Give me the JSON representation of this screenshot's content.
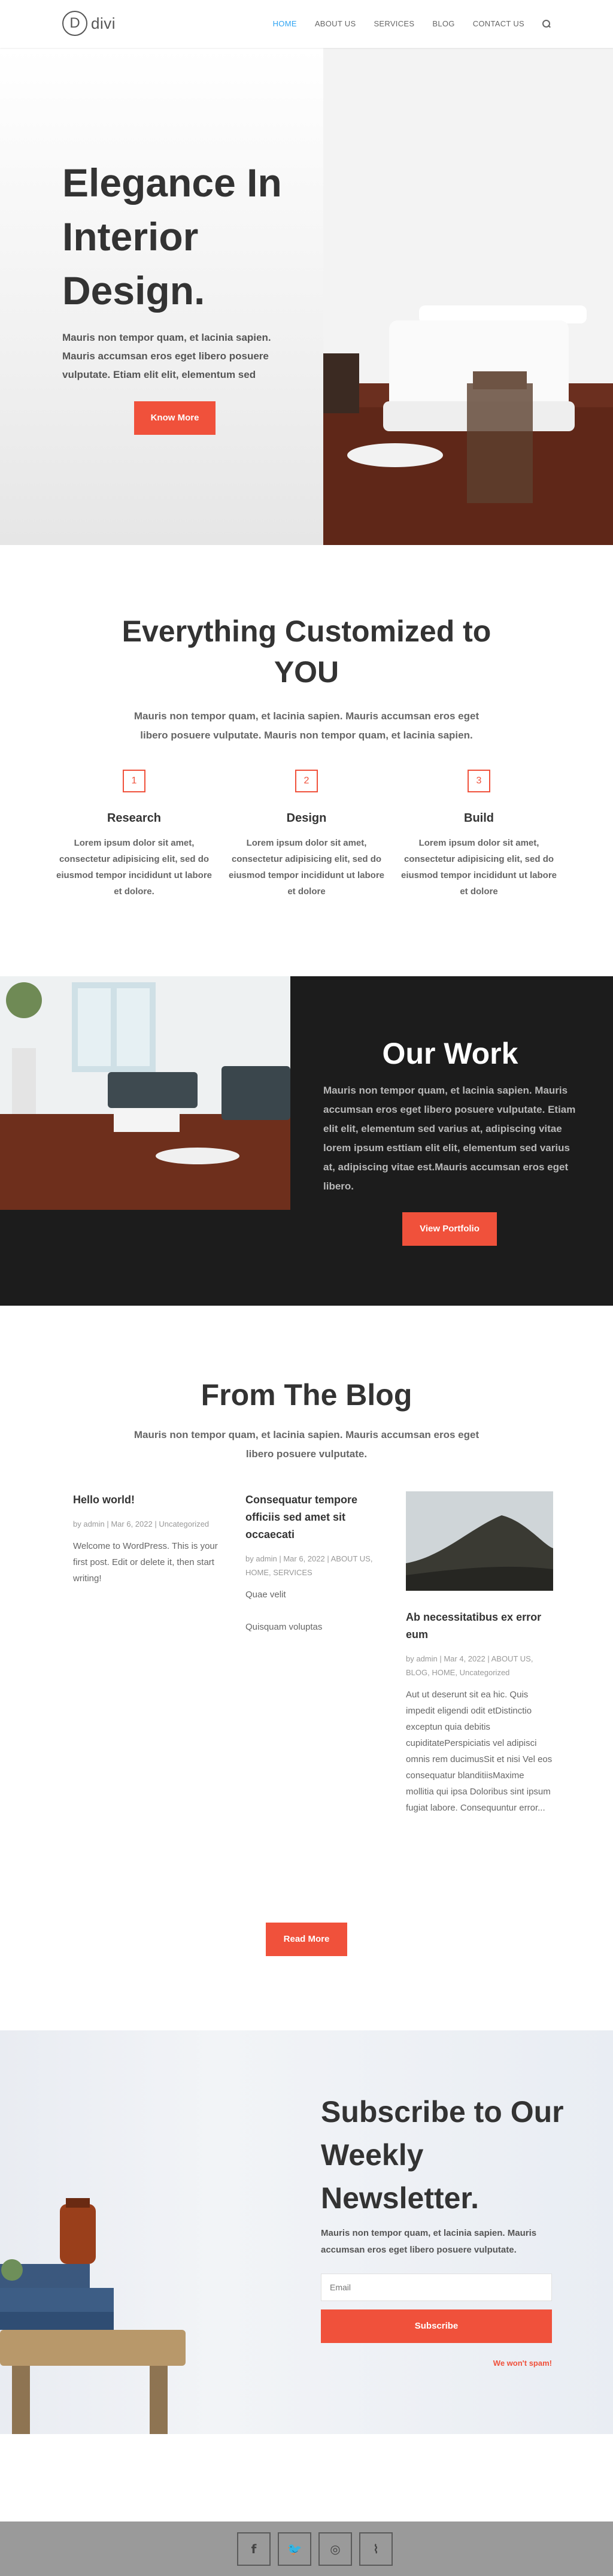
{
  "header": {
    "logo_mark": "D",
    "logo_text": "divi",
    "nav": [
      "HOME",
      "ABOUT US",
      "SERVICES",
      "BLOG",
      "CONTACT US"
    ],
    "accent": "#2ea3f2"
  },
  "hero": {
    "title": "Elegance In Interior Design.",
    "text": "Mauris non tempor quam, et lacinia sapien. Mauris accumsan eros eget libero posuere vulputate. Etiam elit elit, elementum sed",
    "button": "Know More"
  },
  "custom": {
    "title": "Everything Customized to YOU",
    "subtitle": "Mauris non tempor quam, et lacinia sapien. Mauris accumsan eros eget libero posuere vulputate. Mauris non tempor quam, et lacinia sapien.",
    "features": [
      {
        "num": "1",
        "title": "Research",
        "text": "Lorem ipsum dolor sit amet, consectetur adipisicing elit, sed do eiusmod tempor incididunt ut labore et dolore."
      },
      {
        "num": "2",
        "title": "Design",
        "text": "Lorem ipsum dolor sit amet, consectetur adipisicing elit, sed do eiusmod tempor incididunt ut labore et dolore"
      },
      {
        "num": "3",
        "title": "Build",
        "text": "Lorem ipsum dolor sit amet, consectetur adipisicing elit, sed do eiusmod tempor incididunt ut labore et dolore"
      }
    ]
  },
  "work": {
    "title": "Our Work",
    "text": "Mauris non tempor quam, et lacinia sapien. Mauris accumsan eros eget libero posuere vulputate. Etiam elit elit, elementum sed varius at, adipiscing vitae lorem ipsum esttiam elit elit, elementum sed varius at, adipiscing vitae est.Mauris accumsan eros eget libero.",
    "button": "View Portfolio"
  },
  "blog": {
    "title": "From The Blog",
    "subtitle": "Mauris non tempor quam, et lacinia sapien. Mauris accumsan eros eget libero posuere vulputate.",
    "posts": [
      {
        "title": "Hello world!",
        "meta": "by admin | Mar 6, 2022 | Uncategorized",
        "body": "Welcome to WordPress. This is your first post. Edit or delete it, then start writing!"
      },
      {
        "title": "Consequatur tempore officiis sed amet sit occaecati",
        "meta": "by admin | Mar 6, 2022 | ABOUT US, HOME, SERVICES",
        "body": "Quae velit\n\nQuisquam voluptas"
      },
      {
        "title": "Ab necessitatibus ex error eum",
        "meta": "by admin | Mar 4, 2022 | ABOUT US, BLOG, HOME, Uncategorized",
        "body": "Aut ut deserunt sit ea hic. Quis impedit eligendi odit etDistinctio exceptun quia debitis cupiditatePerspiciatis vel adipisci omnis rem ducimusSit et nisi Vel eos consequatur blanditiisMaxime mollitia qui ipsa Doloribus sint ipsum fugiat labore. Consequuntur error..."
      }
    ],
    "button": "Read More"
  },
  "newsletter": {
    "title": "Subscribe to Our Weekly Newsletter.",
    "text": "Mauris non tempor quam, et lacinia sapien. Mauris accumsan eros eget libero posuere vulputate.",
    "email_placeholder": "Email",
    "button": "Subscribe",
    "spam": "We won't spam!"
  },
  "footer": {
    "socials": [
      {
        "icon": "facebook-icon",
        "glyph": "f"
      },
      {
        "icon": "twitter-icon",
        "glyph": "🐦"
      },
      {
        "icon": "instagram-icon",
        "glyph": "◎"
      },
      {
        "icon": "rss-icon",
        "glyph": "⌇"
      }
    ]
  },
  "colors": {
    "accent": "#f0513b",
    "dark": "#1c1c1c"
  }
}
